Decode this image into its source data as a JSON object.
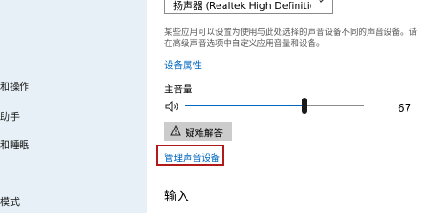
{
  "nav": {
    "items": [
      {
        "label": "和操作"
      },
      {
        "label": "助手"
      },
      {
        "label": "和睡眠"
      },
      {
        "label": "模式"
      }
    ]
  },
  "output": {
    "device_selected": "扬声器 (Realtek High Definition Audi...",
    "description": "某些应用可以设置为使用与此处选择的声音设备不同的声音设备。请在高级声音选项中自定义应用音量和设备。",
    "device_properties_link": "设备属性",
    "master_volume_label": "主音量",
    "volume_value": "67",
    "volume_level": 0.67,
    "troubleshoot_label": "疑难解答",
    "manage_devices_link": "管理声音设备"
  },
  "input": {
    "section_title": "输入"
  },
  "colors": {
    "accent": "#0067c0",
    "nav_background": "#e6f0f6",
    "highlight_border": "#b01a1a",
    "button_background": "#cccccc"
  },
  "icons": {
    "speaker": "speaker-icon",
    "warning": "warning-icon",
    "chevron": "chevron-down-icon"
  }
}
